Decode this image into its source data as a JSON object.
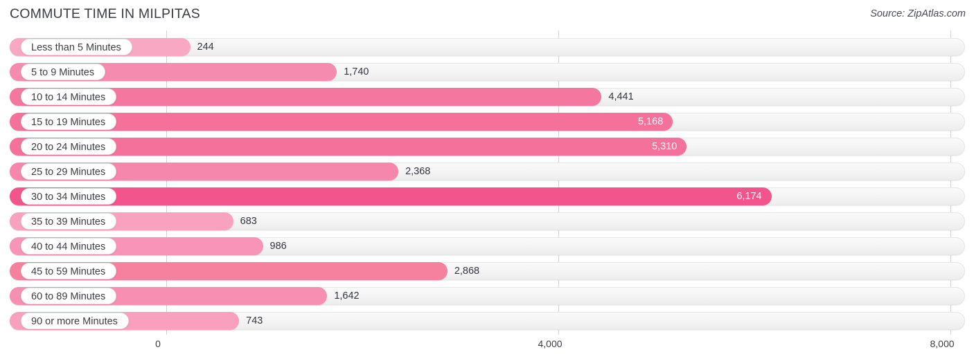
{
  "header": {
    "title": "COMMUTE TIME IN MILPITAS",
    "source": "Source: ZipAtlas.com"
  },
  "axis": {
    "ticks": [
      "0",
      "4,000",
      "8,000"
    ],
    "tick_values": [
      0,
      4000,
      8000
    ],
    "min": 0,
    "max": 8000
  },
  "colors": {
    "bar_light": "#f9a8c4",
    "bar_mid": "#f486ab",
    "bar_strong": "#f2709c",
    "bar_deep": "#f0548a",
    "track": "#f4f4f4",
    "gridline": "#d4d4d4",
    "text": "#3c3c46",
    "value_inside": "#ffffff"
  },
  "chart_data": {
    "type": "bar",
    "orientation": "horizontal",
    "title": "COMMUTE TIME IN MILPITAS",
    "xlabel": "",
    "ylabel": "",
    "xlim": [
      0,
      8000
    ],
    "grid": true,
    "legend": false,
    "source": "Source: ZipAtlas.com",
    "categories": [
      "Less than 5 Minutes",
      "5 to 9 Minutes",
      "10 to 14 Minutes",
      "15 to 19 Minutes",
      "20 to 24 Minutes",
      "25 to 29 Minutes",
      "30 to 34 Minutes",
      "35 to 39 Minutes",
      "40 to 44 Minutes",
      "45 to 59 Minutes",
      "60 to 89 Minutes",
      "90 or more Minutes"
    ],
    "values": [
      244,
      1740,
      4441,
      5168,
      5310,
      2368,
      6174,
      683,
      986,
      2868,
      1642,
      743
    ],
    "value_labels": [
      "244",
      "1,740",
      "4,441",
      "5,168",
      "5,310",
      "2,368",
      "6,174",
      "683",
      "986",
      "2,868",
      "1,642",
      "743"
    ]
  },
  "rows": [
    {
      "label": "Less than 5 Minutes",
      "value": 244,
      "value_label": "244",
      "color": "#f9a8c4",
      "inside": false
    },
    {
      "label": "5 to 9 Minutes",
      "value": 1740,
      "value_label": "1,740",
      "color": "#f58cb0",
      "inside": false
    },
    {
      "label": "10 to 14 Minutes",
      "value": 4441,
      "value_label": "4,441",
      "color": "#f4779f",
      "inside": false
    },
    {
      "label": "15 to 19 Minutes",
      "value": 5168,
      "value_label": "5,168",
      "color": "#f4719b",
      "inside": true
    },
    {
      "label": "20 to 24 Minutes",
      "value": 5310,
      "value_label": "5,310",
      "color": "#f4719b",
      "inside": true
    },
    {
      "label": "25 to 29 Minutes",
      "value": 2368,
      "value_label": "2,368",
      "color": "#f586ac",
      "inside": false
    },
    {
      "label": "30 to 34 Minutes",
      "value": 6174,
      "value_label": "6,174",
      "color": "#f2558c",
      "inside": true
    },
    {
      "label": "35 to 39 Minutes",
      "value": 683,
      "value_label": "683",
      "color": "#f9a2c0",
      "inside": false
    },
    {
      "label": "40 to 44 Minutes",
      "value": 986,
      "value_label": "986",
      "color": "#f794b7",
      "inside": false
    },
    {
      "label": "45 to 59 Minutes",
      "value": 2868,
      "value_label": "2,868",
      "color": "#f5819f",
      "inside": false
    },
    {
      "label": "60 to 89 Minutes",
      "value": 1642,
      "value_label": "1,642",
      "color": "#f78fb2",
      "inside": false
    },
    {
      "label": "90 or more Minutes",
      "value": 743,
      "value_label": "743",
      "color": "#f9a0bf",
      "inside": false
    }
  ]
}
